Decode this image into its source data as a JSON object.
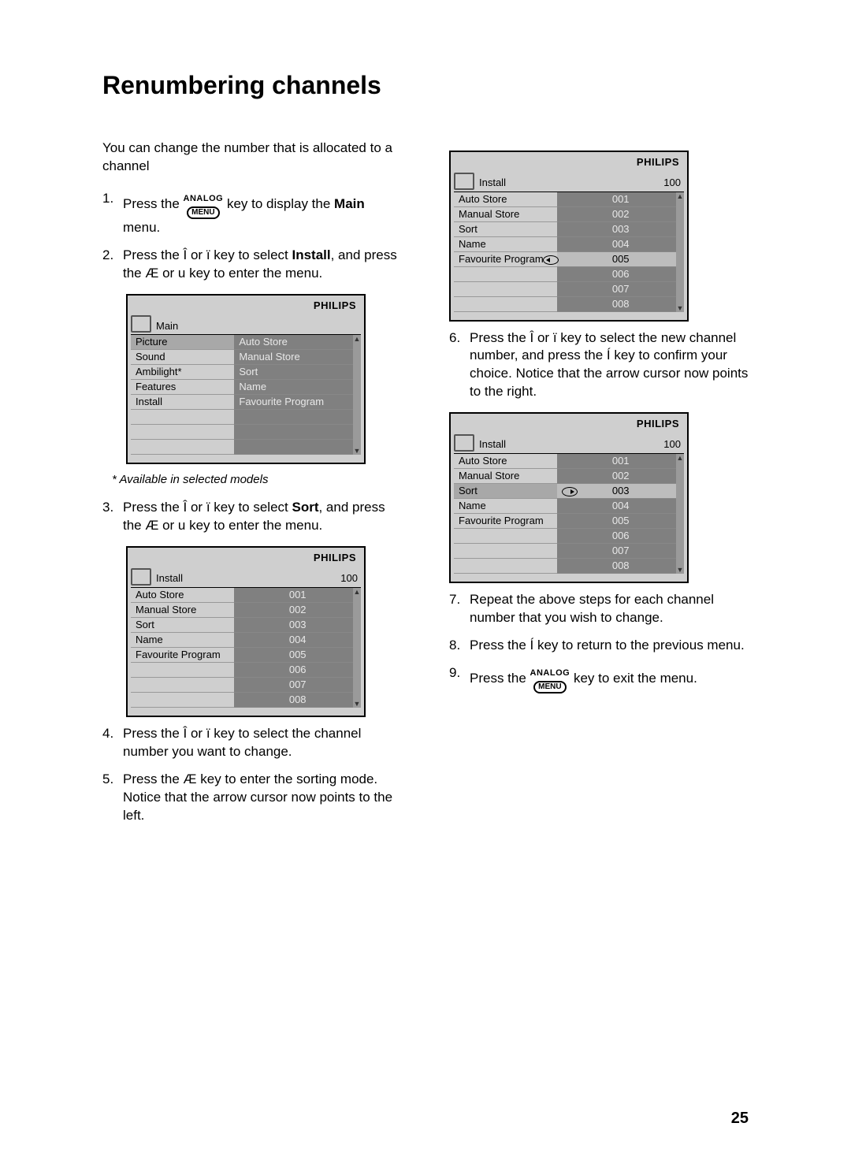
{
  "title": "Renumbering channels",
  "intro": "You can change the number that is allocated to a channel",
  "menukey": {
    "top": "ANALOG",
    "label": "MENU"
  },
  "steps": {
    "s1a": "Press the ",
    "s1b": " key to display the ",
    "s1bold": "Main",
    "s1c": " menu.",
    "s2a": "Press the Î or ï key to select ",
    "s2bold": "Install",
    "s2b": ", and press the Æ or u key to enter the menu.",
    "s3a": "Press the Î or ï key to select ",
    "s3bold": "Sort",
    "s3b": ", and press the Æ or u key to enter the menu.",
    "s4": "Press the Î or ï key to select the channel number you want to change.",
    "s5": "Press the Æ key to enter the sorting mode.  Notice that the arrow cursor now points to the left.",
    "s6": "Press the Î or ï key to select the new channel number, and press the Í key to confirm your choice.  Notice that the arrow cursor now points to the right.",
    "s7": "Repeat the above steps for each channel number that you wish to change.",
    "s8": "Press the Í key to return to the previous menu.",
    "s9a": "Press the ",
    "s9b": " key to exit the menu."
  },
  "footnote": "* Available in selected models",
  "brand": "PHILIPS",
  "osd_main": {
    "title": "Main",
    "left": [
      "Picture",
      "Sound",
      "Ambilight*",
      "Features",
      "Install"
    ],
    "right": [
      "Auto Store",
      "Manual Store",
      "Sort",
      "Name",
      "Favourite Program"
    ]
  },
  "osd_install": {
    "title": "Install",
    "num": "100",
    "left": [
      "Auto Store",
      "Manual Store",
      "Sort",
      "Name",
      "Favourite Program"
    ],
    "right": [
      "001",
      "002",
      "003",
      "004",
      "005",
      "006",
      "007",
      "008"
    ]
  },
  "page_number": "25"
}
